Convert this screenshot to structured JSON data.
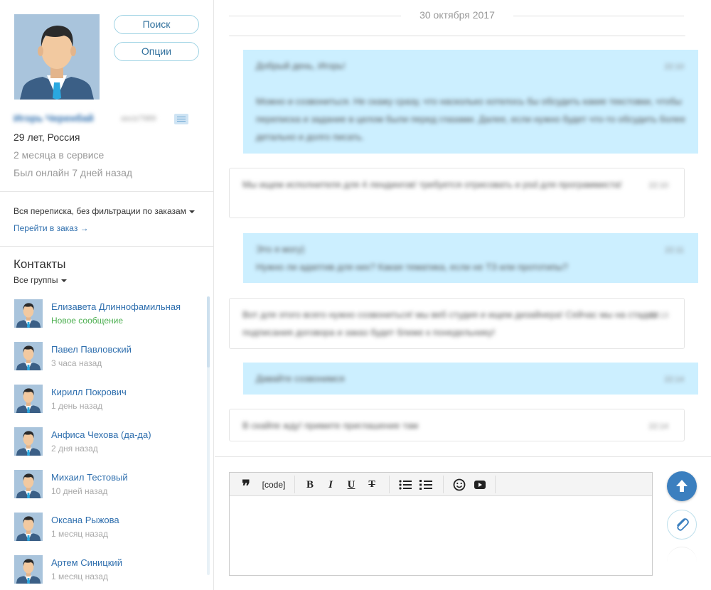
{
  "profile": {
    "name": "Игорь Черенбай",
    "user_id": "asciz7989",
    "age_country": "29 лет, Россия",
    "service_time": "2 месяца в сервисе",
    "last_online": "Был онлайн 7 дней назад",
    "search_button": "Поиск",
    "options_button": "Опции"
  },
  "filter": {
    "label": "Вся переписка, без фильтрации по заказам",
    "order_link": "Перейти в заказ →"
  },
  "contacts": {
    "title": "Контакты",
    "groups_label": "Все группы",
    "items": [
      {
        "name": "Елизавета Длиннофамильная",
        "status": "Новое сообщение"
      },
      {
        "name": "Павел Павловский",
        "status": "3 часа назад"
      },
      {
        "name": "Кирилл Покрович",
        "status": "1 день назад"
      },
      {
        "name": "Анфиса Чехова (да-да)",
        "status": "2 дня назад"
      },
      {
        "name": "Михаил Тестовый",
        "status": "10 дней назад"
      },
      {
        "name": "Оксана Рыжова",
        "status": "1 месяц назад"
      },
      {
        "name": "Артем Синицкий",
        "status": "1 месяц назад"
      }
    ]
  },
  "chat": {
    "date": "30 октября 2017",
    "messages": [
      {
        "direction": "out",
        "time": "22:10",
        "text": "Добрый день, Игорь!\n\nМожно и созвониться. Не скажу сразу, что насколько хотелось бы обсудить какие текстовки, чтобы переписка и задание в целом были перед глазами. Далее, если нужно будет что-то обсудить более детально и долго писать."
      },
      {
        "direction": "in",
        "time": "22:10",
        "text": "Мы ищем исполнителя для 4 лендингов! требуется отрисовать и psd для программиста!"
      },
      {
        "direction": "out",
        "time": "22:11",
        "text": "Это я могу)\nНужно ли адаптив для них? Какая тематика, если не ТЗ или прототипы?"
      },
      {
        "direction": "in",
        "time": "22:13",
        "text": "Вот для этого всего нужно созвониться! мы веб студия и ищем дизайнера! Сейчас мы на стадии подписания договора и заказ будет ближе к понедельнику!"
      },
      {
        "direction": "out",
        "time": "22:14",
        "text": "Давайте созвонимся"
      },
      {
        "direction": "in",
        "time": "22:14",
        "text": "В скайпе жду! примите приглашение там"
      }
    ]
  },
  "editor": {
    "quote_label": "❞",
    "code_label": "[code]",
    "bold_label": "B",
    "italic_label": "I",
    "underline_label": "U",
    "strike_label": "T",
    "value": ""
  },
  "colors": {
    "link": "#2f6fae",
    "outgoing_bubble": "#ccefff",
    "new_status": "#4caf50",
    "send_button": "#3b7fbf",
    "pill_border": "#9fd3e4"
  },
  "icons": {
    "note": "note-icon",
    "list": "bullet-list-icon",
    "ordered_list": "numbered-list-icon",
    "smile": "smile-icon",
    "video": "video-icon",
    "send": "arrow-up-icon",
    "attach": "paperclip-icon"
  }
}
